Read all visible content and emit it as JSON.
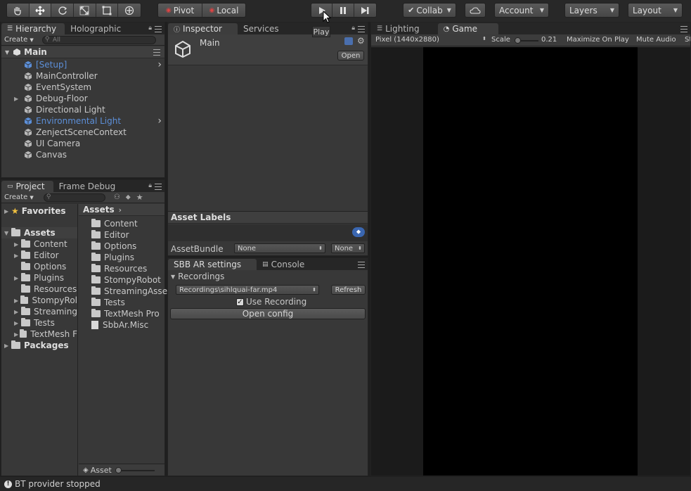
{
  "toolbar": {
    "pivot_label": "Pivot",
    "local_label": "Local",
    "collab_label": "Collab",
    "account_label": "Account",
    "layers_label": "Layers",
    "layout_label": "Layout",
    "play_tooltip": "Play"
  },
  "hierarchy": {
    "tabs": [
      "Hierarchy",
      "Holographic"
    ],
    "create_label": "Create",
    "search_placeholder": "All",
    "scene_name": "Main",
    "items": [
      {
        "label": "[Setup]",
        "highlight": true,
        "arrow": true
      },
      {
        "label": "MainController"
      },
      {
        "label": "EventSystem"
      },
      {
        "label": "Debug-Floor",
        "expandable": true
      },
      {
        "label": "Directional Light"
      },
      {
        "label": "Environmental Light",
        "highlight": true,
        "arrow": true
      },
      {
        "label": "ZenjectSceneContext"
      },
      {
        "label": "UI Camera"
      },
      {
        "label": "Canvas"
      }
    ]
  },
  "project": {
    "tabs": [
      "Project",
      "Frame Debug"
    ],
    "create_label": "Create",
    "tree": {
      "favorites": "Favorites",
      "assets": "Assets",
      "asset_children": [
        "Content",
        "Editor",
        "Options",
        "Plugins",
        "Resources",
        "StompyRol",
        "Streaming",
        "Tests",
        "TextMesh F"
      ],
      "packages": "Packages"
    },
    "breadcrumb": "Assets",
    "files": [
      "Content",
      "Editor",
      "Options",
      "Plugins",
      "Resources",
      "StompyRobot",
      "StreamingAsset",
      "Tests",
      "TextMesh Pro",
      "SbbAr.Misc"
    ],
    "bottom_label": "Asset"
  },
  "inspector": {
    "tabs": [
      "Inspector",
      "Services"
    ],
    "object_name": "Main",
    "open_label": "Open",
    "asset_labels_title": "Asset Labels",
    "assetbundle_label": "AssetBundle",
    "assetbundle_value": "None",
    "assetbundle_variant": "None"
  },
  "sbb": {
    "tabs": [
      "SBB AR settings",
      "Console"
    ],
    "section_title": "Recordings",
    "recording_value": "Recordings\\sihlquai-far.mp4",
    "refresh_label": "Refresh",
    "use_recording_label": "Use Recording",
    "use_recording_checked": true,
    "open_config_label": "Open config"
  },
  "game": {
    "tabs": [
      "Lighting",
      "Game"
    ],
    "resolution": "Pixel (1440x2880)",
    "scale_label": "Scale",
    "scale_value": "0.21",
    "maximize_label": "Maximize On Play",
    "mute_label": "Mute Audio",
    "stats_label": "St"
  },
  "status": {
    "message": "BT provider stopped"
  },
  "colors": {
    "highlight_blue": "#5c8fd8",
    "panel_bg": "#383838"
  }
}
